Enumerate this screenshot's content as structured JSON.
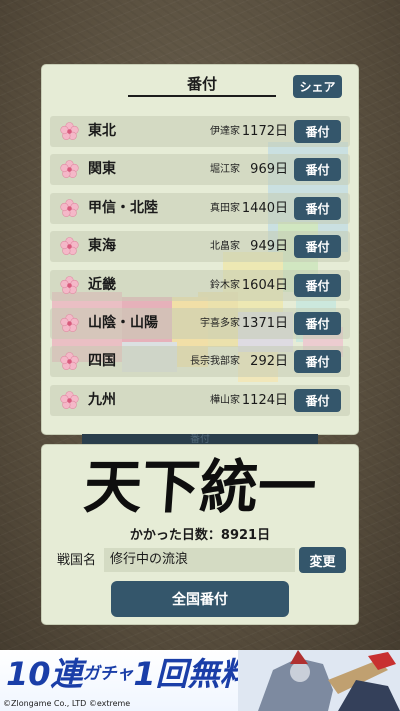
{
  "panel": {
    "title": "番付",
    "share_label": "シェア"
  },
  "rows": [
    {
      "region": "東北",
      "clan": "伊達家",
      "days": "1172日",
      "button": "番付"
    },
    {
      "region": "関東",
      "clan": "堀江家",
      "days": "969日",
      "button": "番付"
    },
    {
      "region": "甲信・北陸",
      "clan": "真田家",
      "days": "1440日",
      "button": "番付"
    },
    {
      "region": "東海",
      "clan": "北畠家",
      "days": "949日",
      "button": "番付"
    },
    {
      "region": "近畿",
      "clan": "鈴木家",
      "days": "1604日",
      "button": "番付"
    },
    {
      "region": "山陰・山陽",
      "clan": "宇喜多家",
      "days": "1371日",
      "button": "番付"
    },
    {
      "region": "四国",
      "clan": "長宗我部家",
      "days": "292日",
      "button": "番付"
    },
    {
      "region": "九州",
      "clan": "樺山家",
      "days": "1124日",
      "button": "番付"
    }
  ],
  "hidden_tab": "番付",
  "summary": {
    "logo_text": "天下統一",
    "days_total": "かかった日数：8921日",
    "name_label": "戦国名",
    "name_value": "修行中の流浪",
    "change_label": "変更",
    "all_ranking_label": "全国番付"
  },
  "ad": {
    "main_1": "10連",
    "main_small": "ガチャ",
    "main_2": "1回無料",
    "copyright": "©Zlongame Co., LTD ©extreme"
  },
  "colors": {
    "button": "#34566b",
    "panel": "#e6ecd6",
    "background": "#5a5040",
    "flower": "#f4b8c8"
  }
}
